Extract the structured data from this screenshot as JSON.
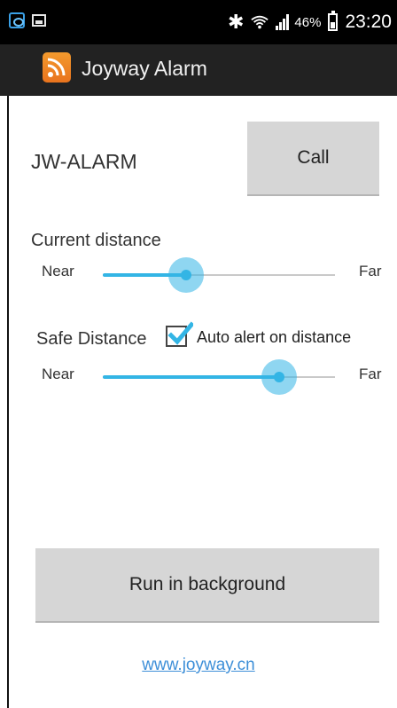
{
  "status_bar": {
    "battery_percent": "46%",
    "time": "23:20",
    "icons": [
      "cloud-sync-icon",
      "image-icon",
      "bluetooth-icon",
      "wifi-icon",
      "signal-icon",
      "battery-icon"
    ]
  },
  "action_bar": {
    "title": "Joyway Alarm",
    "logo_icon": "rss-app-icon",
    "logo_color": "#f39a2d"
  },
  "device": {
    "name": "JW-ALARM",
    "call_label": "Call"
  },
  "current_distance": {
    "label": "Current distance",
    "min_label": "Near",
    "max_label": "Far",
    "value": 0.36
  },
  "safe_distance": {
    "label": "Safe Distance",
    "auto_alert_label": "Auto alert on distance",
    "auto_alert_checked": true,
    "min_label": "Near",
    "max_label": "Far",
    "value": 0.76
  },
  "run_background_label": "Run in background",
  "website_link": "www.joyway.cn",
  "colors": {
    "accent": "#33b5e5",
    "actionbar": "#222222",
    "button": "#d6d6d6"
  }
}
